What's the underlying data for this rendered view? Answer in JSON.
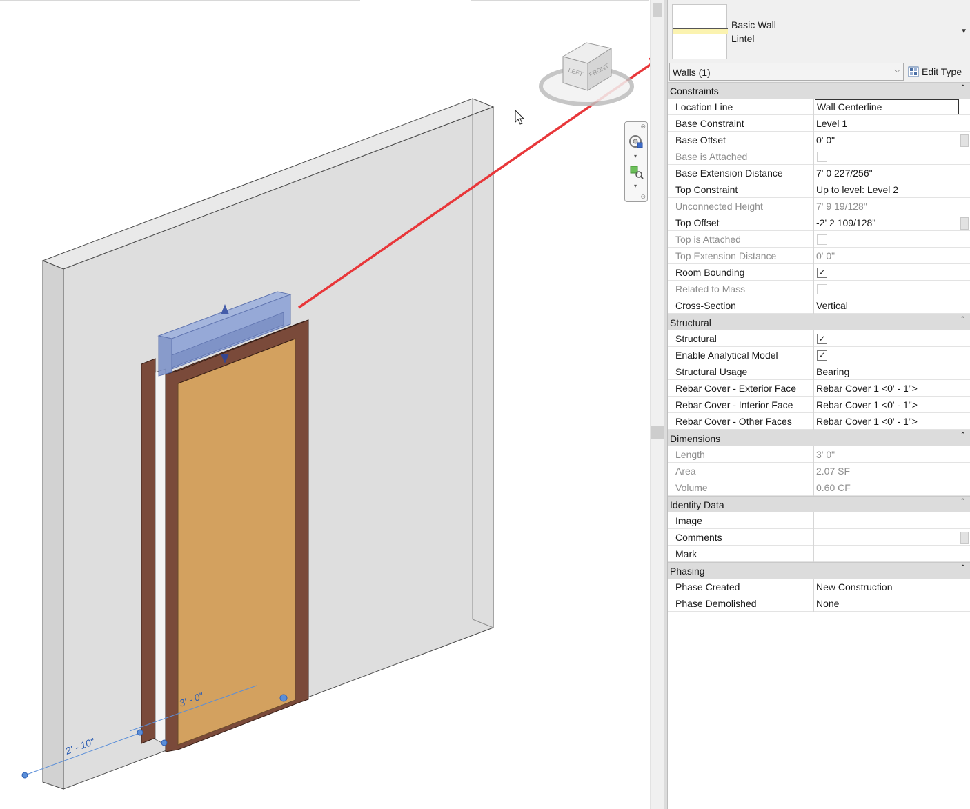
{
  "viewport": {
    "viewcube": {
      "left_label": "LEFT",
      "front_label": "FRONT"
    },
    "dimensions": [
      {
        "label": "2' - 10\""
      },
      {
        "label": "3' - 0\""
      }
    ],
    "colors": {
      "wall": "#dcdcdc",
      "door_panel": "#d3a15f",
      "door_frame": "#7a4a3a",
      "lintel": "#7f98cf",
      "annotation_arrow": "#e8373a",
      "dimension": "#5a8ed8"
    }
  },
  "properties": {
    "type_selector": {
      "family": "Basic Wall",
      "type": "Lintel"
    },
    "filter": {
      "selected": "Walls (1)"
    },
    "edit_type_label": "Edit Type",
    "groups": [
      {
        "name": "Constraints",
        "rows": [
          {
            "name": "Location Line",
            "value": "Wall Centerline",
            "editing": true
          },
          {
            "name": "Base Constraint",
            "value": "Level 1"
          },
          {
            "name": "Base Offset",
            "value": "0'  0\"",
            "button": true
          },
          {
            "name": "Base is Attached",
            "checkbox": false,
            "readonly": true
          },
          {
            "name": "Base Extension Distance",
            "value": "7'  0 227/256\""
          },
          {
            "name": "Top Constraint",
            "value": "Up to level: Level 2"
          },
          {
            "name": "Unconnected Height",
            "value": "7'  9 19/128\"",
            "readonly": true
          },
          {
            "name": "Top Offset",
            "value": "-2'  2 109/128\"",
            "button": true
          },
          {
            "name": "Top is Attached",
            "checkbox": false,
            "readonly": true
          },
          {
            "name": "Top Extension Distance",
            "value": "0'  0\"",
            "readonly": true
          },
          {
            "name": "Room Bounding",
            "checkbox": true
          },
          {
            "name": "Related to Mass",
            "checkbox": false,
            "readonly": true
          },
          {
            "name": "Cross-Section",
            "value": "Vertical"
          }
        ]
      },
      {
        "name": "Structural",
        "rows": [
          {
            "name": "Structural",
            "checkbox": true
          },
          {
            "name": "Enable Analytical Model",
            "checkbox": true
          },
          {
            "name": "Structural Usage",
            "value": "Bearing"
          },
          {
            "name": "Rebar Cover - Exterior Face",
            "value": "Rebar Cover 1 <0' - 1\">"
          },
          {
            "name": "Rebar Cover - Interior Face",
            "value": "Rebar Cover 1 <0' - 1\">"
          },
          {
            "name": "Rebar Cover - Other Faces",
            "value": "Rebar Cover 1 <0' - 1\">"
          }
        ]
      },
      {
        "name": "Dimensions",
        "rows": [
          {
            "name": "Length",
            "value": "3'  0\"",
            "readonly": true
          },
          {
            "name": "Area",
            "value": "2.07 SF",
            "readonly": true
          },
          {
            "name": "Volume",
            "value": "0.60 CF",
            "readonly": true
          }
        ]
      },
      {
        "name": "Identity Data",
        "rows": [
          {
            "name": "Image",
            "value": ""
          },
          {
            "name": "Comments",
            "value": "",
            "button": true
          },
          {
            "name": "Mark",
            "value": ""
          }
        ]
      },
      {
        "name": "Phasing",
        "rows": [
          {
            "name": "Phase Created",
            "value": "New Construction"
          },
          {
            "name": "Phase Demolished",
            "value": "None"
          }
        ]
      }
    ]
  }
}
